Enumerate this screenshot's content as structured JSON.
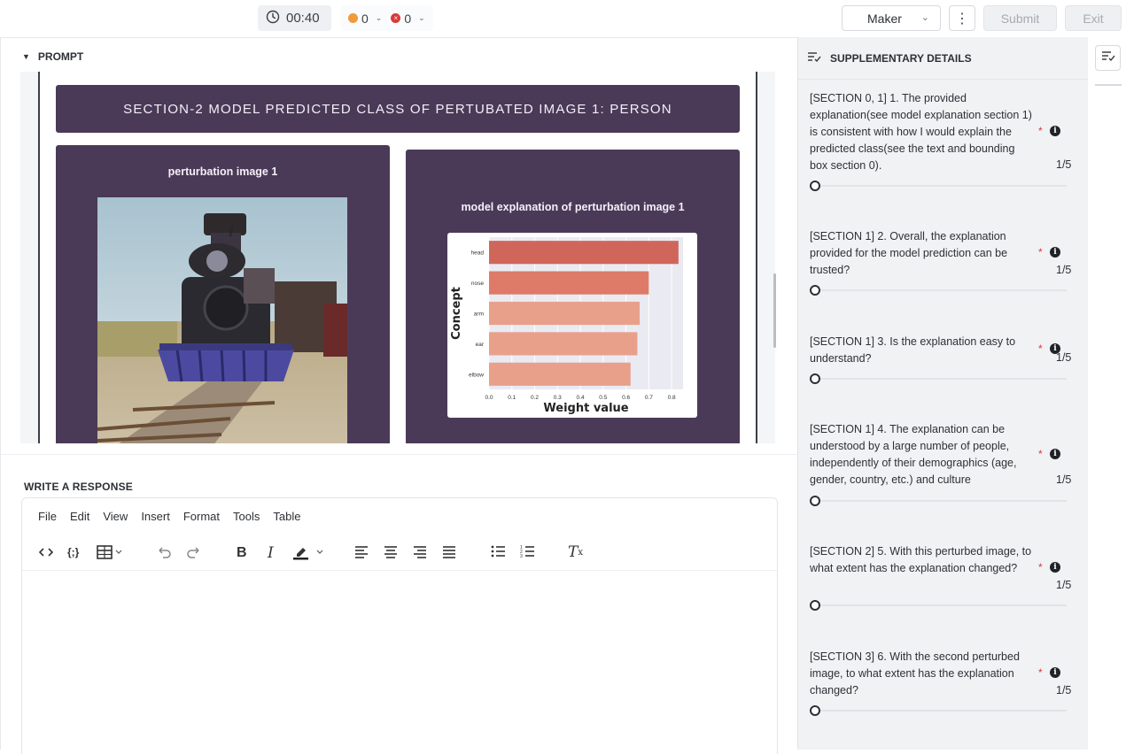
{
  "topbar": {
    "timer": "00:40",
    "count_orange": "0",
    "count_red": "0",
    "role": "Maker",
    "submit_label": "Submit",
    "exit_label": "Exit"
  },
  "prompt": {
    "header": "PROMPT",
    "section_title": "SECTION-2 MODEL PREDICTED CLASS OF PERTUBATED IMAGE 1: PERSON",
    "left_caption": "perturbation image 1",
    "right_caption": "model explanation of perturbation image 1"
  },
  "chart_data": {
    "type": "bar",
    "orientation": "horizontal",
    "categories": [
      "head",
      "nose",
      "arm",
      "ear",
      "elbow"
    ],
    "values": [
      0.83,
      0.7,
      0.66,
      0.65,
      0.62
    ],
    "xlabel": "Weight value",
    "ylabel": "Concept",
    "xlim": [
      0.0,
      0.85
    ],
    "xticks": [
      "0.0",
      "0.1",
      "0.2",
      "0.3",
      "0.4",
      "0.5",
      "0.6",
      "0.7",
      "0.8"
    ],
    "colors": [
      "#d0665a",
      "#dd7a68",
      "#e8a08a",
      "#e8a08a",
      "#e8a08a"
    ],
    "grid": true
  },
  "response": {
    "label": "WRITE A RESPONSE",
    "menu": [
      "File",
      "Edit",
      "View",
      "Insert",
      "Format",
      "Tools",
      "Table"
    ],
    "toolbar_icons": [
      "code-icon",
      "code-braces-icon",
      "table-icon",
      "undo-icon",
      "redo-icon",
      "bold-icon",
      "italic-icon",
      "highlight-icon",
      "align-left-icon",
      "align-center-icon",
      "align-right-icon",
      "align-justify-icon",
      "bullet-list-icon",
      "numbered-list-icon",
      "clear-format-icon"
    ]
  },
  "supplementary": {
    "title": "SUPPLEMENTARY DETAILS",
    "questions": [
      {
        "text": "[SECTION 0, 1] 1. The provided explanation(see model explanation section 1) is consistent with how I would explain the predicted class(see the text and bounding box section 0).",
        "score": "1/5",
        "value": 1
      },
      {
        "text": "[SECTION 1] 2. Overall, the explanation provided for the model prediction can be trusted?",
        "score": "1/5",
        "value": 1
      },
      {
        "text": "[SECTION 1] 3. Is the explanation easy to understand?",
        "score": "1/5",
        "value": 1
      },
      {
        "text": "[SECTION 1] 4. The explanation can be understood by a large number of people, independently of their demographics (age, gender, country, etc.) and culture",
        "score": "1/5",
        "value": 1
      },
      {
        "text": "[SECTION 2] 5. With this perturbed image, to what extent has the explanation changed?",
        "score": "1/5",
        "value": 1
      },
      {
        "text": "[SECTION 3] 6. With the second perturbed image, to what extent has the explanation changed?",
        "score": "1/5",
        "value": 1
      }
    ]
  }
}
